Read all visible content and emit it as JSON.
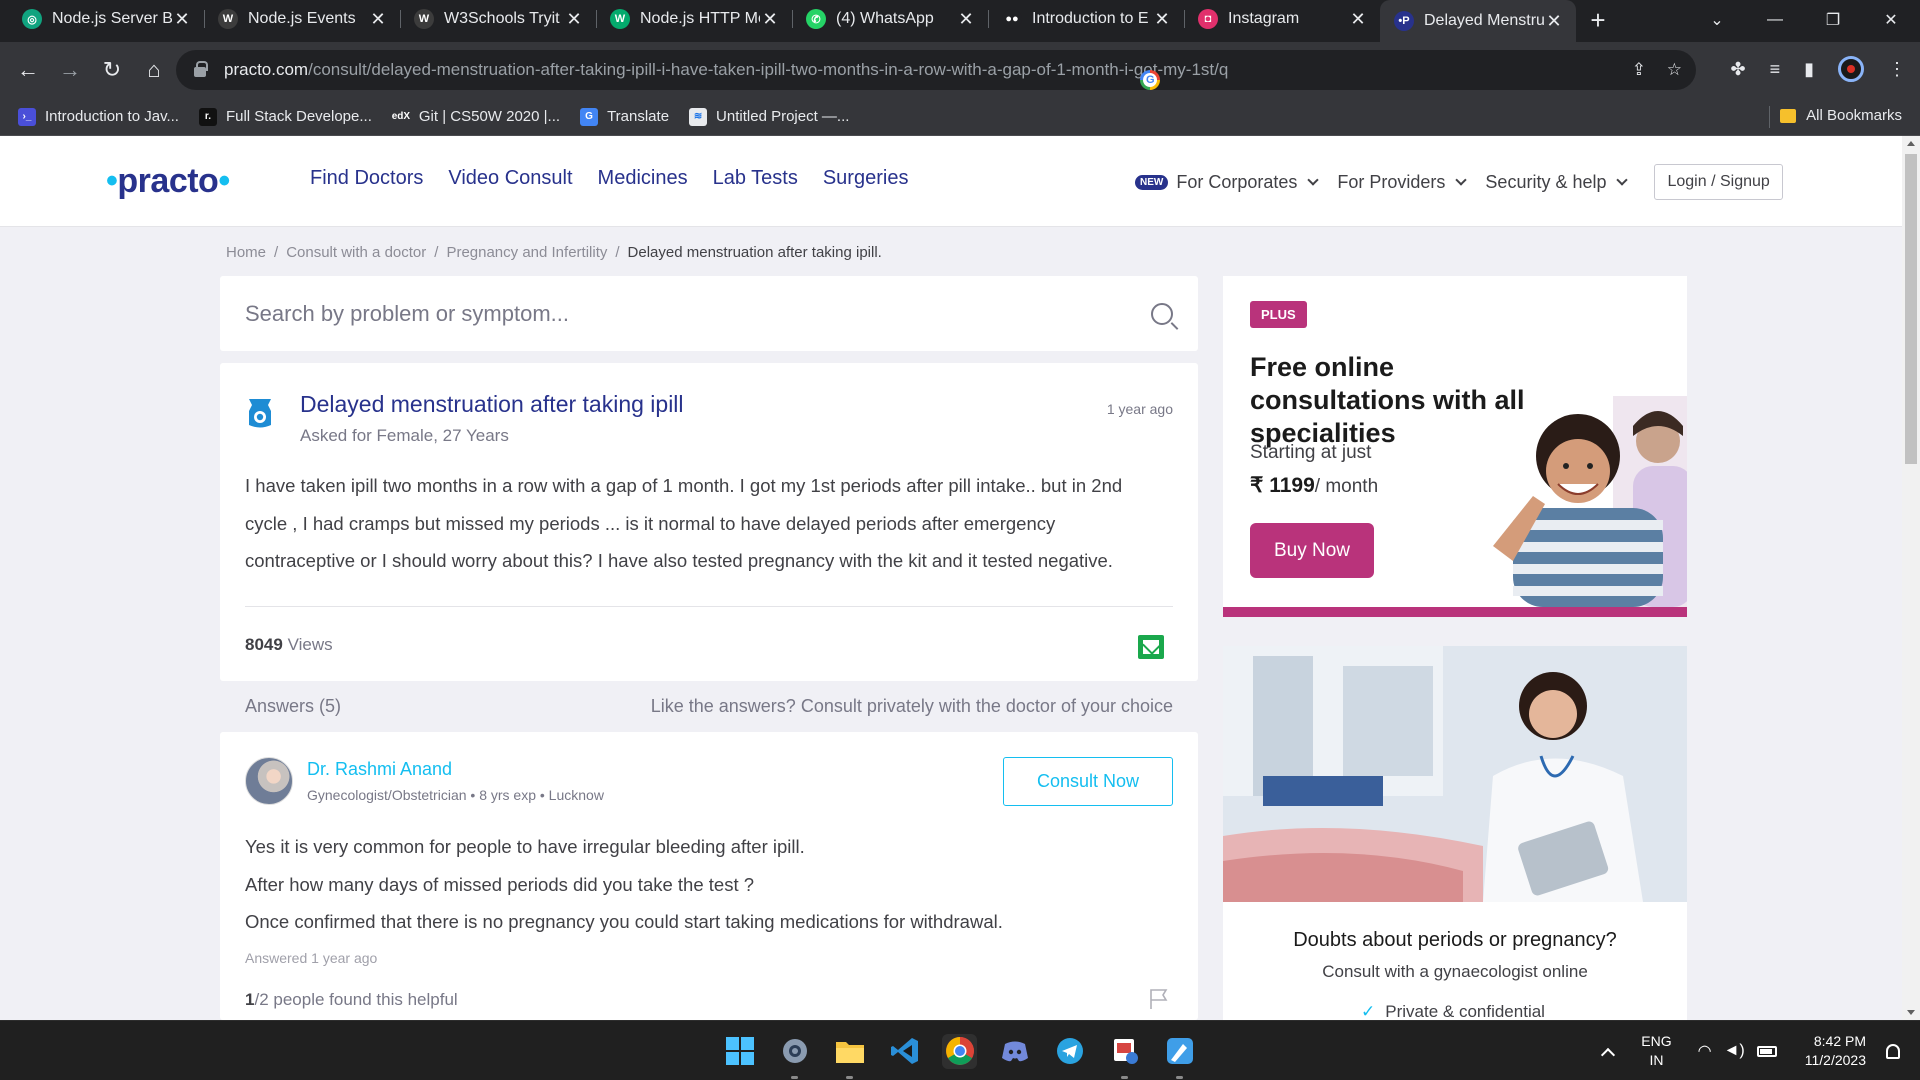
{
  "browser": {
    "tabs": [
      {
        "title": "Node.js Server Bl",
        "fav_color": "#10a37f",
        "fav_glyph": "◎"
      },
      {
        "title": "Node.js Events",
        "fav_color": "#3c3c3c",
        "fav_glyph": "W"
      },
      {
        "title": "W3Schools Tryit",
        "fav_color": "#3c3c3c",
        "fav_glyph": "W"
      },
      {
        "title": "Node.js HTTP Mo",
        "fav_color": "#04aa6d",
        "fav_glyph": "W"
      },
      {
        "title": "(4) WhatsApp",
        "fav_color": "#25d366",
        "fav_glyph": "✆"
      },
      {
        "title": "Introduction to E",
        "fav_color": "#202124",
        "fav_glyph": "●●"
      },
      {
        "title": "Instagram",
        "fav_color": "#e1306c",
        "fav_glyph": "◘"
      },
      {
        "title": "Delayed Menstru",
        "fav_color": "#28328c",
        "fav_glyph": "•P"
      }
    ],
    "url_host": "practo.com",
    "url_path": "/consult/delayed-menstruation-after-taking-ipill-i-have-taken-ipill-two-months-in-a-row-with-a-gap-of-1-month-i-got-my-1st/q",
    "bookmarks": [
      {
        "label": "Introduction to Jav...",
        "fav_color": "#4a4fd8",
        "fav_glyph": "›_"
      },
      {
        "label": "Full Stack Develope...",
        "fav_color": "#111111",
        "fav_glyph": "r."
      },
      {
        "label": "Git | CS50W 2020 |...",
        "fav_color": "#35363a",
        "fav_glyph": "edX"
      },
      {
        "label": "Translate",
        "fav_color": "#4285f4",
        "fav_glyph": "G"
      },
      {
        "label": "Untitled Project —...",
        "fav_color": "#e8eaed",
        "fav_glyph": "≋"
      }
    ],
    "all_bookmarks": "All Bookmarks"
  },
  "site": {
    "logo_core": "practo",
    "nav": [
      "Find Doctors",
      "Video Consult",
      "Medicines",
      "Lab Tests",
      "Surgeries"
    ],
    "new_badge": "NEW",
    "right_nav": [
      "For Corporates",
      "For Providers",
      "Security & help"
    ],
    "login": "Login / Signup",
    "brand_colors": {
      "navy": "#28328c",
      "cyan": "#14bef0",
      "plus": "#b9337b"
    }
  },
  "breadcrumb": [
    "Home",
    "Consult with a doctor",
    "Pregnancy and Infertility",
    "Delayed menstruation after taking ipill."
  ],
  "search": {
    "placeholder": "Search by problem or symptom..."
  },
  "question": {
    "title": "Delayed menstruation after taking ipill",
    "asked_for": "Asked for Female, 27 Years",
    "time": "1 year ago",
    "body_lines": [
      "I have taken ipill two months in a row with a gap of 1 month. I got my 1st periods after pill intake.. but in 2nd",
      "cycle , I had cramps but missed my periods ... is it normal to have delayed periods after emergency",
      "contraceptive or I should worry about this? I have also tested pregnancy with the kit and it tested negative."
    ],
    "views_count": "8049",
    "views_label": "Views"
  },
  "answers_header": {
    "count_label": "Answers (5)",
    "prompt": "Like the answers? Consult privately with the doctor of your choice"
  },
  "answer": {
    "doctor": "Dr. Rashmi Anand",
    "meta": "Gynecologist/Obstetrician • 8 yrs exp • Lucknow",
    "consult_button": "Consult Now",
    "lines": [
      "Yes it is very common for people to have irregular bleeding after ipill.",
      "After how many days of missed periods did you take the test ?",
      "Once confirmed that there is no pregnancy you could start taking medications for withdrawal."
    ],
    "answered": "Answered 1 year ago",
    "helpful_num": "1",
    "helpful_rest": "/2 people found this helpful"
  },
  "plus_card": {
    "badge": "PLUS",
    "headline": "Free online consultations with all specialities",
    "starting": "Starting at just",
    "price": "₹ 1199",
    "per": "/ month",
    "button": "Buy Now"
  },
  "doctor_card": {
    "headline": "Doubts about periods or pregnancy?",
    "sub": "Consult with a gynaecologist online",
    "bullet": "Private & confidential"
  },
  "taskbar": {
    "icons": [
      "windows-start",
      "settings",
      "file-explorer",
      "vscode",
      "chrome",
      "discord",
      "telegram",
      "snipping-tool",
      "paint"
    ],
    "lang_top": "ENG",
    "lang_bottom": "IN",
    "time": "8:42 PM",
    "date": "11/2/2023"
  }
}
